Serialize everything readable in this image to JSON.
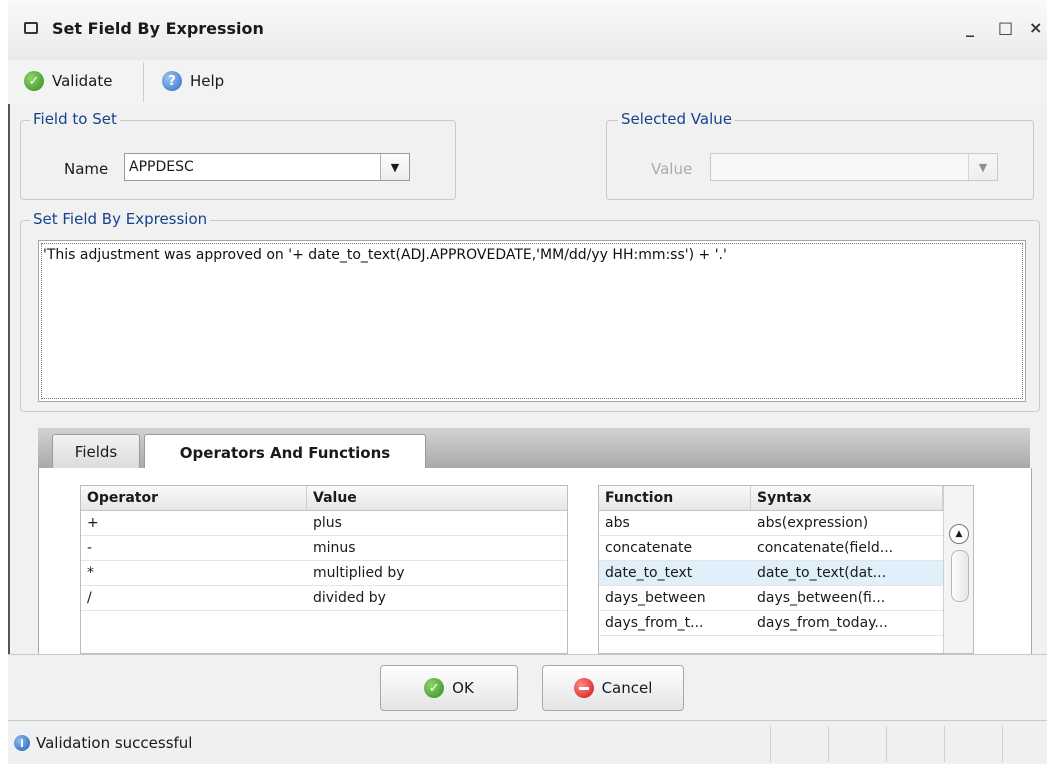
{
  "window": {
    "title": "Set Field By Expression",
    "controls": {
      "minimize": "_",
      "maximize": "□",
      "close": "×"
    }
  },
  "toolbar": {
    "validate_label": "Validate",
    "help_label": "Help"
  },
  "field_to_set": {
    "legend": "Field to Set",
    "name_label": "Name",
    "name_value": "APPDESC"
  },
  "selected_value": {
    "legend": "Selected Value",
    "value_label": "Value",
    "value_value": ""
  },
  "expression": {
    "legend": "Set Field By Expression",
    "text": "'This adjustment was approved on '+ date_to_text(ADJ.APPROVEDATE,'MM/dd/yy HH:mm:ss') + '.'"
  },
  "tabs": [
    {
      "label": "Fields",
      "active": false
    },
    {
      "label": "Operators And Functions",
      "active": true
    }
  ],
  "operators_grid": {
    "columns": [
      "Operator",
      "Value"
    ],
    "rows": [
      [
        "+",
        "plus"
      ],
      [
        "-",
        "minus"
      ],
      [
        "*",
        "multiplied by"
      ],
      [
        "/",
        "divided by"
      ]
    ]
  },
  "functions_grid": {
    "columns": [
      "Function",
      "Syntax"
    ],
    "rows": [
      [
        "abs",
        "abs(expression)"
      ],
      [
        "concatenate",
        "concatenate(field..."
      ],
      [
        "date_to_text",
        "date_to_text(dat..."
      ],
      [
        "days_between",
        "days_between(fi..."
      ],
      [
        "days_from_t...",
        "days_from_today..."
      ]
    ],
    "selected_row": 2
  },
  "buttons": {
    "ok_label": "OK",
    "cancel_label": "Cancel"
  },
  "status": {
    "text": "Validation successful"
  },
  "icons": {
    "validate": "check-circle-icon",
    "help": "help-circle-icon",
    "ok": "check-circle-icon",
    "cancel": "minus-circle-icon",
    "status": "info-circle-icon"
  },
  "colors": {
    "legend_text": "#15428b",
    "selected_row": "#dff0fb",
    "ok_green": "#2f8f1b",
    "cancel_red": "#d11212",
    "info_blue": "#1e5fb3"
  }
}
